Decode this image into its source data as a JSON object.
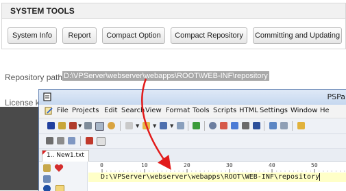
{
  "system_tools": {
    "title": "SYSTEM TOOLS",
    "buttons": [
      "System Info",
      "Report",
      "Compact Option",
      "Compact Repository",
      "Committing and Updating"
    ]
  },
  "repository": {
    "label": "Repository path:",
    "value": "D:\\VPServer\\webserver\\webapps\\ROOT\\WEB-INF\\repository"
  },
  "license": {
    "label": "License k"
  },
  "ide": {
    "title": "PSPa",
    "menu": [
      "File",
      "Projects",
      "Edit",
      "Search",
      "View",
      "Format",
      "Tools",
      "Scripts",
      "HTML",
      "Settings",
      "Window",
      "He"
    ],
    "tab_label": "1.. New1.txt",
    "ruler_marks": [
      "0",
      "10",
      "20",
      "30",
      "40",
      "50"
    ],
    "code_line": "D:\\VPServer\\webserver\\webapps\\ROOT\\WEB-INF\\repository",
    "colors": {
      "highlight_line": "#ffffc8",
      "arrow": "#e21b1b"
    }
  }
}
